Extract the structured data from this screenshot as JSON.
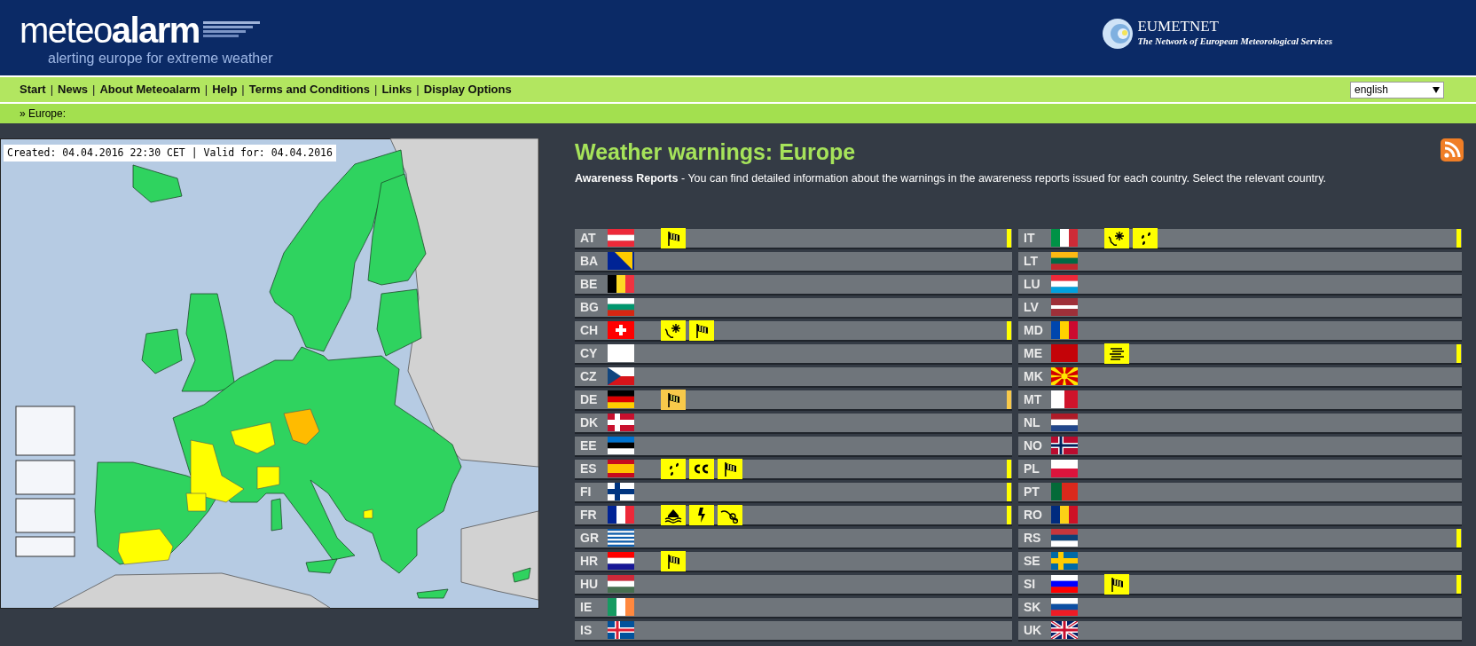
{
  "header": {
    "logo": "meteo**alarm**",
    "tagline": "alerting europe for extreme weather",
    "partner_name": "EUMETNET",
    "partner_tagline": "The Network of European Meteorological Services"
  },
  "nav": {
    "items": [
      {
        "kind": "link",
        "label": "Start"
      },
      {
        "kind": "separator",
        "label": "|"
      },
      {
        "kind": "link",
        "label": "News"
      },
      {
        "kind": "separator",
        "label": "|"
      },
      {
        "kind": "link",
        "label": "About Meteoalarm"
      },
      {
        "kind": "separator",
        "label": "|"
      },
      {
        "kind": "link",
        "label": "Help"
      },
      {
        "kind": "separator",
        "label": "|"
      },
      {
        "kind": "link",
        "label": "Terms and Conditions"
      },
      {
        "kind": "separator",
        "label": "|"
      },
      {
        "kind": "link",
        "label": "Links"
      },
      {
        "kind": "separator",
        "label": "|"
      },
      {
        "kind": "link",
        "label": "Display Options"
      }
    ],
    "language": "english"
  },
  "breadcrumb": "» Europe:",
  "map": {
    "caption": "Created: 04.04.2016 22:30 CET | Valid for: 04.04.2016"
  },
  "title": "Weather warnings: Europe",
  "intro": "**Awareness Reports** - You can find detailed information about the warnings in the awareness reports issued for each country. Select the relevant country.",
  "columns": [
    [
      {
        "code": "AT",
        "color": "#ffff00",
        "warnings": [
          {
            "kind": "wind",
            "color": "#ffff00"
          }
        ]
      },
      {
        "code": "BA"
      },
      {
        "code": "BE"
      },
      {
        "code": "BG"
      },
      {
        "code": "CH",
        "color": "#ffff00",
        "warnings": [
          {
            "kind": "snow-ice",
            "color": "#ffff00"
          },
          {
            "kind": "wind",
            "color": "#ffff00"
          }
        ]
      },
      {
        "code": "CY"
      },
      {
        "code": "CZ"
      },
      {
        "code": "DE",
        "color": "#f8c94a",
        "warnings": [
          {
            "kind": "wind",
            "color": "#f8c94a"
          }
        ]
      },
      {
        "code": "DK"
      },
      {
        "code": "EE"
      },
      {
        "code": "ES",
        "color": "#ffff00",
        "warnings": [
          {
            "kind": "rain",
            "color": "#ffff00"
          },
          {
            "kind": "coastal",
            "color": "#ffff00"
          },
          {
            "kind": "wind",
            "color": "#ffff00"
          }
        ]
      },
      {
        "code": "FI",
        "color": "#ffff00"
      },
      {
        "code": "FR",
        "color": "#ffff00",
        "warnings": [
          {
            "kind": "flood",
            "color": "#ffff00"
          },
          {
            "kind": "thunderstorm",
            "color": "#ffff00"
          },
          {
            "kind": "avalanche",
            "color": "#ffff00"
          }
        ]
      },
      {
        "code": "GR"
      },
      {
        "code": "HR",
        "warnings": [
          {
            "kind": "wind",
            "color": "#ffff00"
          }
        ]
      },
      {
        "code": "HU"
      },
      {
        "code": "IE"
      },
      {
        "code": "IS"
      }
    ],
    [
      {
        "code": "IT",
        "color": "#ffff00",
        "warnings": [
          {
            "kind": "snow-ice",
            "color": "#ffff00"
          },
          {
            "kind": "rain",
            "color": "#ffff00"
          }
        ]
      },
      {
        "code": "LT"
      },
      {
        "code": "LU"
      },
      {
        "code": "LV"
      },
      {
        "code": "MD"
      },
      {
        "code": "ME",
        "color": "#ffff00",
        "warnings": [
          {
            "kind": "fog",
            "color": "#ffff00"
          }
        ]
      },
      {
        "code": "MK"
      },
      {
        "code": "MT"
      },
      {
        "code": "NL"
      },
      {
        "code": "NO"
      },
      {
        "code": "PL"
      },
      {
        "code": "PT"
      },
      {
        "code": "RO"
      },
      {
        "code": "RS",
        "color": "#ffff00"
      },
      {
        "code": "SE"
      },
      {
        "code": "SI",
        "color": "#ffff00",
        "warnings": [
          {
            "kind": "wind",
            "color": "#ffff00"
          }
        ]
      },
      {
        "code": "SK"
      },
      {
        "code": "UK"
      }
    ]
  ]
}
